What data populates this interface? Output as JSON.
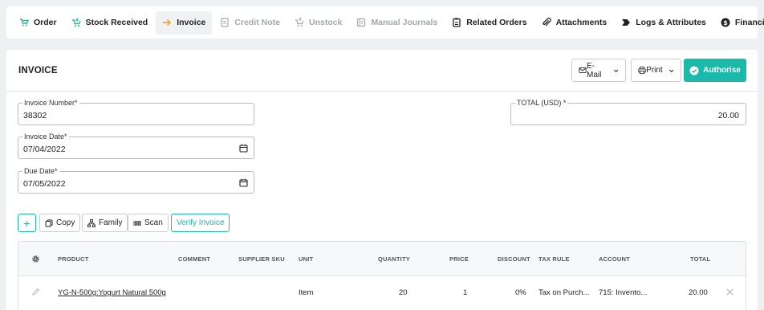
{
  "tabs": [
    {
      "label": "Order",
      "icon": "cart-icon",
      "state": "normal"
    },
    {
      "label": "Stock Received",
      "icon": "cart-download-icon",
      "state": "normal"
    },
    {
      "label": "Invoice",
      "icon": "arrow-right-icon",
      "state": "active"
    },
    {
      "label": "Credit Note",
      "icon": "document-icon",
      "state": "disabled"
    },
    {
      "label": "Unstock",
      "icon": "cart-upload-icon",
      "state": "disabled"
    },
    {
      "label": "Manual Journals",
      "icon": "journal-icon",
      "state": "disabled"
    },
    {
      "label": "Related Orders",
      "icon": "clipboard-icon",
      "state": "normal"
    },
    {
      "label": "Attachments",
      "icon": "paperclip-icon",
      "state": "normal"
    },
    {
      "label": "Logs & Attributes",
      "icon": "tag-icon",
      "state": "normal"
    },
    {
      "label": "Financials",
      "icon": "dollar-circle-icon",
      "state": "normal"
    }
  ],
  "header": {
    "title": "INVOICE",
    "email_label": "E-Mail",
    "print_label": "Print",
    "authorise_label": "Authorise"
  },
  "form": {
    "invoice_number": {
      "label": "Invoice Number*",
      "value": "38302"
    },
    "invoice_date": {
      "label": "Invoice Date*",
      "value": "07/04/2022"
    },
    "due_date": {
      "label": "Due Date*",
      "value": "07/05/2022"
    },
    "total": {
      "label": "TOTAL (USD) *",
      "value": "20.00"
    }
  },
  "actions": {
    "add": "+",
    "copy": "Copy",
    "family": "Family",
    "scan": "Scan",
    "verify": "Verify Invoice"
  },
  "table": {
    "columns": [
      "PRODUCT",
      "COMMENT",
      "SUPPLIER SKU",
      "UNIT",
      "QUANTITY",
      "PRICE",
      "DISCOUNT",
      "TAX RULE",
      "ACCOUNT",
      "TOTAL"
    ],
    "rows": [
      {
        "product": "YG-N-500g:Yogurt Natural 500g",
        "comment": "",
        "supplier_sku": "",
        "unit": "Item",
        "quantity": "20",
        "price": "1",
        "discount": "0%",
        "tax_rule": "Tax on Purch...",
        "account": "715: Invento...",
        "total": "20.00"
      }
    ]
  },
  "colors": {
    "accent": "#1bb9a8",
    "arrow_icon": "#f0a020"
  }
}
